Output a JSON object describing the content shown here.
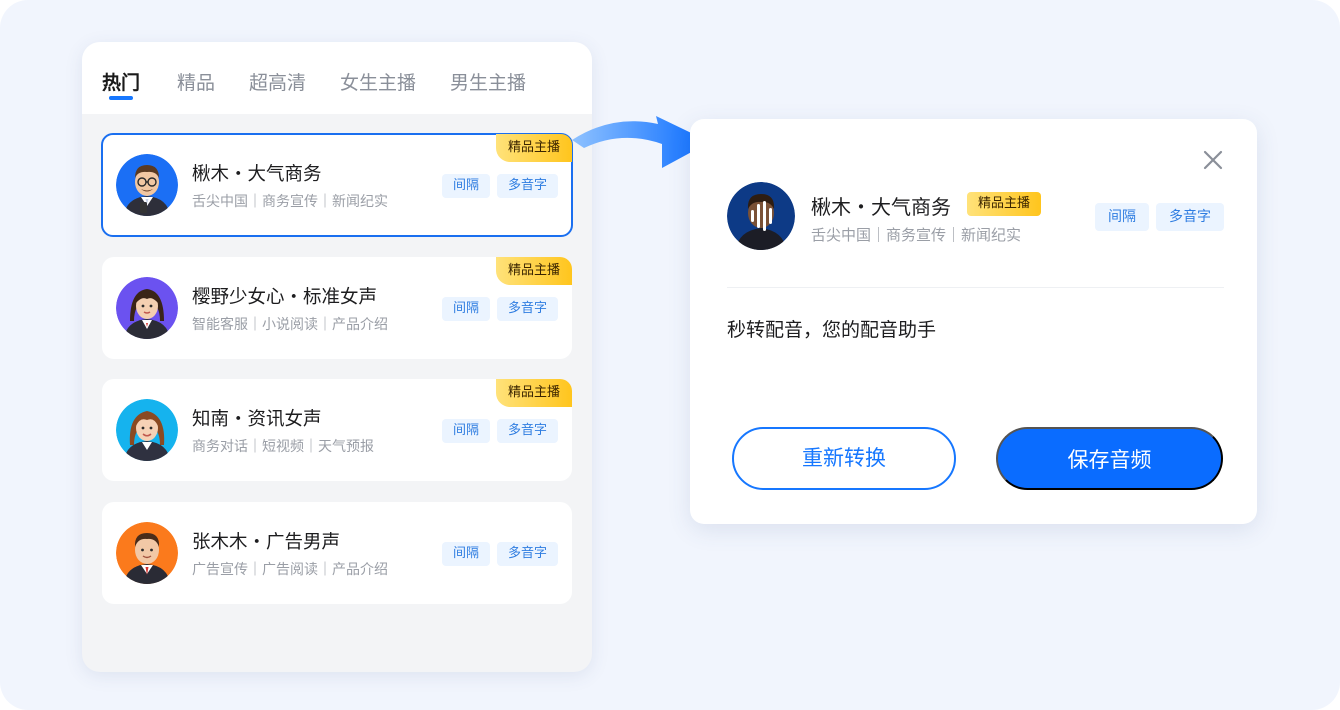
{
  "tabs": [
    {
      "label": "热门",
      "active": true
    },
    {
      "label": "精品",
      "active": false
    },
    {
      "label": "超高清",
      "active": false
    },
    {
      "label": "女生主播",
      "active": false
    },
    {
      "label": "男生主播",
      "active": false
    }
  ],
  "voices": [
    {
      "name": "楸木・大气商务",
      "desc": "舌尖中国｜商务宣传｜新闻纪实",
      "tags": [
        "间隔",
        "多音字"
      ],
      "badge": "精品主播",
      "selected": true,
      "avatar_color": "#1b6ff5"
    },
    {
      "name": "樱野少女心・标准女声",
      "desc": "智能客服｜小说阅读｜产品介绍",
      "tags": [
        "间隔",
        "多音字"
      ],
      "badge": "精品主播",
      "selected": false,
      "avatar_color": "#6b52f0"
    },
    {
      "name": "知南・资讯女声",
      "desc": "商务对话｜短视频｜天气预报",
      "tags": [
        "间隔",
        "多音字"
      ],
      "badge": "精品主播",
      "selected": false,
      "avatar_color": "#15b3ee"
    },
    {
      "name": "张木木・广告男声",
      "desc": "广告宣传｜广告阅读｜产品介绍",
      "tags": [
        "间隔",
        "多音字"
      ],
      "badge": "",
      "selected": false,
      "avatar_color": "#fb7a1c"
    }
  ],
  "dialog": {
    "name": "楸木・大气商务",
    "badge": "精品主播",
    "desc": "舌尖中国｜商务宣传｜新闻纪实",
    "tags": [
      "间隔",
      "多音字"
    ],
    "text": "秒转配音，您的配音助手",
    "reconvert_label": "重新转换",
    "save_label": "保存音频"
  },
  "colors": {
    "accent": "#1677ff",
    "tag_text": "#2f7de1",
    "tag_bg": "#ebf4ff",
    "badge_gold": "#ffc51d",
    "background": "#f1f5fd"
  },
  "icons": {
    "close": "close-icon",
    "arrow": "curved-arrow-icon",
    "waveform": "audio-waveform-icon"
  }
}
